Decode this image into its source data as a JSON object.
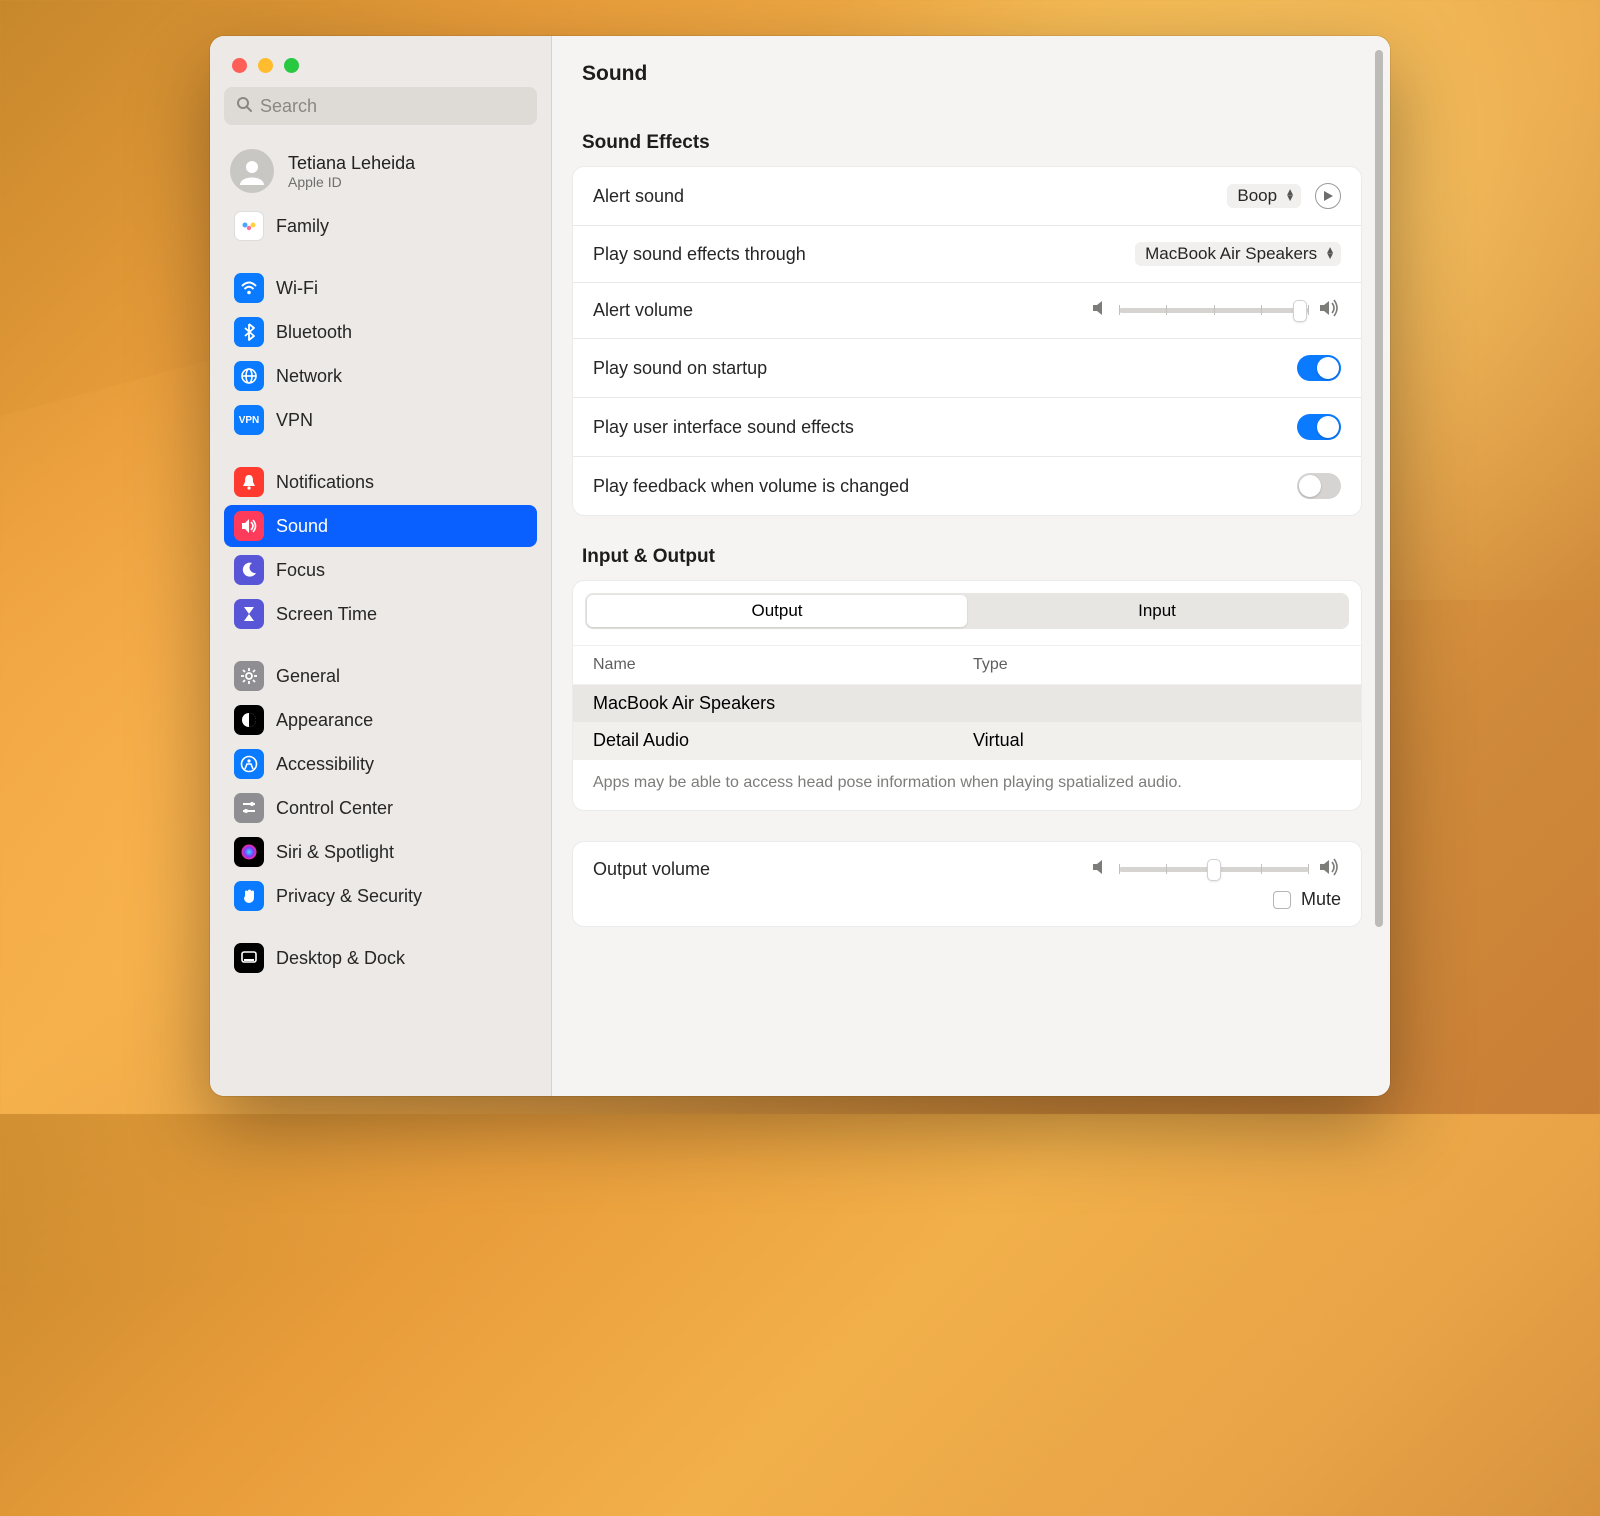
{
  "search": {
    "placeholder": "Search"
  },
  "account": {
    "name": "Tetiana Leheida",
    "sub": "Apple ID"
  },
  "sidebar": {
    "family": "Family",
    "groups": [
      [
        "Wi-Fi",
        "Bluetooth",
        "Network",
        "VPN"
      ],
      [
        "Notifications",
        "Sound",
        "Focus",
        "Screen Time"
      ],
      [
        "General",
        "Appearance",
        "Accessibility",
        "Control Center",
        "Siri & Spotlight",
        "Privacy & Security"
      ],
      [
        "Desktop & Dock"
      ]
    ],
    "selected": "Sound"
  },
  "header": {
    "title": "Sound"
  },
  "sections": {
    "effects_title": "Sound Effects",
    "io_title": "Input & Output"
  },
  "effects": {
    "alert_sound": {
      "label": "Alert sound",
      "value": "Boop"
    },
    "play_through": {
      "label": "Play sound effects through",
      "value": "MacBook Air Speakers"
    },
    "alert_volume": {
      "label": "Alert volume",
      "value_pct": 95
    },
    "startup": {
      "label": "Play sound on startup",
      "on": true
    },
    "ui_effects": {
      "label": "Play user interface sound effects",
      "on": true
    },
    "feedback": {
      "label": "Play feedback when volume is changed",
      "on": false
    }
  },
  "io": {
    "segments": {
      "output": "Output",
      "input": "Input",
      "active": "Output"
    },
    "columns": {
      "name": "Name",
      "type": "Type"
    },
    "devices": [
      {
        "name": "MacBook Air Speakers",
        "type": ""
      },
      {
        "name": "Detail Audio",
        "type": "Virtual"
      }
    ],
    "note": "Apps may be able to access head pose information when playing spatialized audio."
  },
  "output_volume": {
    "label": "Output volume",
    "value_pct": 50,
    "mute_label": "Mute",
    "muted": false
  },
  "icons": {
    "family": {
      "bg": "#ffffff",
      "glyph": "👨‍👩‍👧",
      "txt": "#000"
    },
    "Wi-Fi": {
      "bg": "#0a7aff",
      "glyph": "wifi"
    },
    "Bluetooth": {
      "bg": "#0a7aff",
      "glyph": "bt"
    },
    "Network": {
      "bg": "#0a7aff",
      "glyph": "globe"
    },
    "VPN": {
      "bg": "#0a7aff",
      "glyph": "vpn"
    },
    "Notifications": {
      "bg": "#ff3b30",
      "glyph": "bell"
    },
    "Sound": {
      "bg": "#ff3b5c",
      "glyph": "speaker",
      "selected_bg": "#ff3b5c"
    },
    "Focus": {
      "bg": "#5856d6",
      "glyph": "moon"
    },
    "Screen Time": {
      "bg": "#5856d6",
      "glyph": "hourglass"
    },
    "General": {
      "bg": "#8e8e93",
      "glyph": "gear"
    },
    "Appearance": {
      "bg": "#000000",
      "glyph": "contrast"
    },
    "Accessibility": {
      "bg": "#0a7aff",
      "glyph": "person"
    },
    "Control Center": {
      "bg": "#8e8e93",
      "glyph": "sliders"
    },
    "Siri & Spotlight": {
      "bg": "#000000",
      "glyph": "siri"
    },
    "Privacy & Security": {
      "bg": "#0a7aff",
      "glyph": "hand"
    },
    "Desktop & Dock": {
      "bg": "#000000",
      "glyph": "dock"
    }
  }
}
